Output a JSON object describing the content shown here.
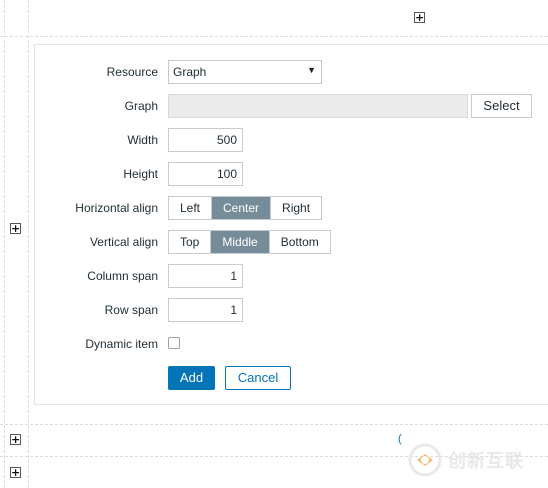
{
  "form": {
    "resource": {
      "label": "Resource",
      "value": "Graph"
    },
    "graph": {
      "label": "Graph",
      "value": "",
      "select_label": "Select"
    },
    "width": {
      "label": "Width",
      "value": "500"
    },
    "height": {
      "label": "Height",
      "value": "100"
    },
    "halign": {
      "label": "Horizontal align",
      "options": [
        "Left",
        "Center",
        "Right"
      ],
      "selected": "Center"
    },
    "valign": {
      "label": "Vertical align",
      "options": [
        "Top",
        "Middle",
        "Bottom"
      ],
      "selected": "Middle"
    },
    "colspan": {
      "label": "Column span",
      "value": "1"
    },
    "rowspan": {
      "label": "Row span",
      "value": "1"
    },
    "dynamic": {
      "label": "Dynamic item",
      "checked": false
    },
    "actions": {
      "add_label": "Add",
      "cancel_label": "Cancel"
    }
  },
  "grid": {
    "plus_symbol": "+"
  },
  "partial_text": "(",
  "watermark": {
    "text": "创新互联"
  },
  "colors": {
    "accent": "#0275b8",
    "segment_active": "#768d99",
    "disabled_field": "#ebebeb"
  }
}
